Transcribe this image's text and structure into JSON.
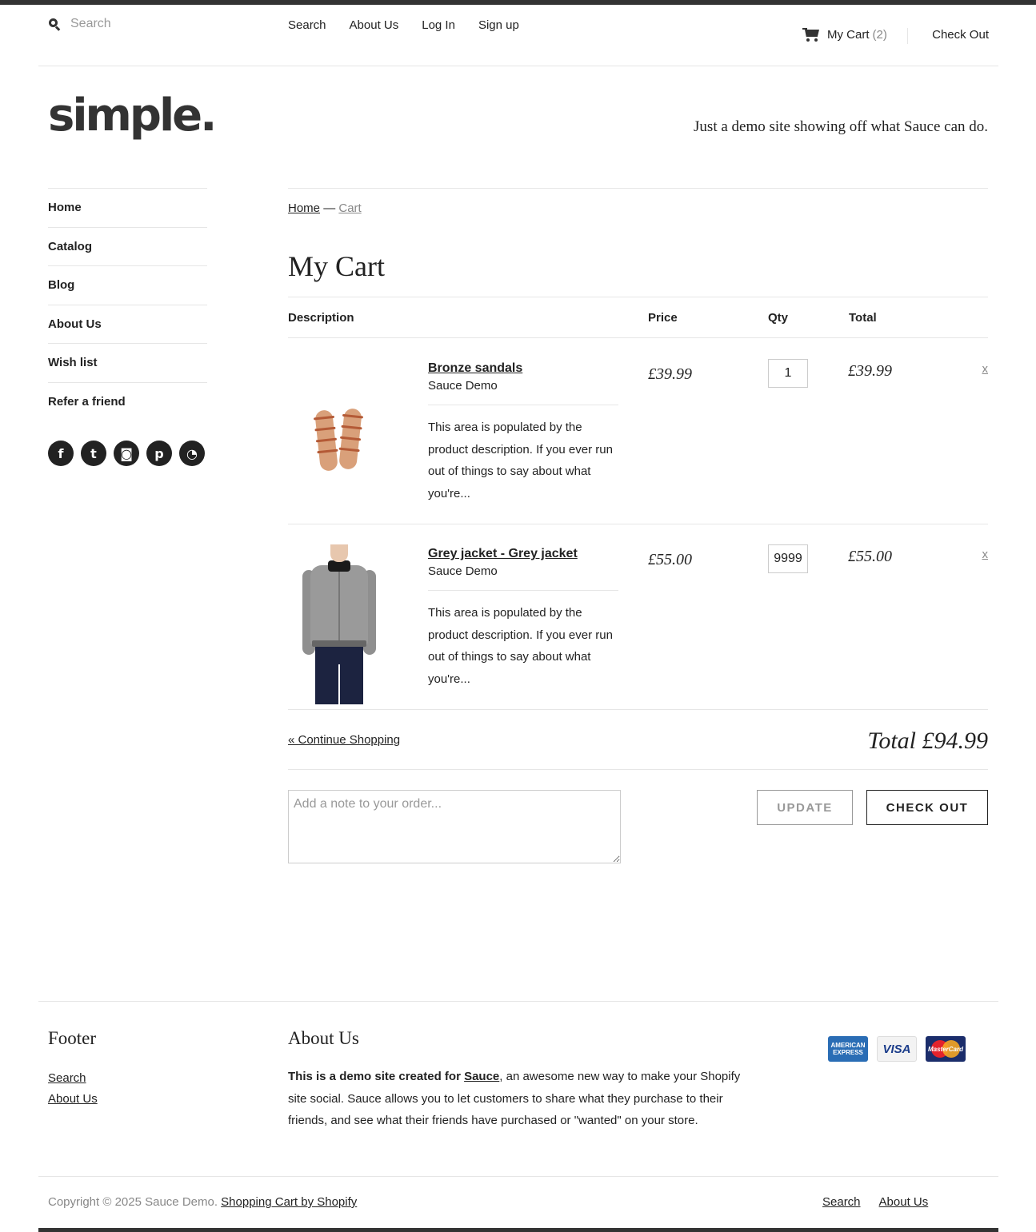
{
  "header": {
    "search_placeholder": "Search",
    "nav": [
      "Search",
      "About Us",
      "Log In",
      "Sign up"
    ],
    "cart_label": "My Cart",
    "cart_count": "(2)",
    "checkout_label": "Check Out"
  },
  "brand": {
    "logo": "simple.",
    "tagline": "Just a demo site showing off what Sauce can do."
  },
  "sidebar": {
    "items": [
      "Home",
      "Catalog",
      "Blog",
      "About Us",
      "Wish list",
      "Refer a friend"
    ],
    "social": [
      {
        "icon": "facebook-icon",
        "glyph": "f"
      },
      {
        "icon": "twitter-icon",
        "glyph": "t"
      },
      {
        "icon": "instagram-icon",
        "glyph": "◙"
      },
      {
        "icon": "pinterest-icon",
        "glyph": "p"
      },
      {
        "icon": "rss-icon",
        "glyph": "◔"
      }
    ]
  },
  "breadcrumb": {
    "home": "Home",
    "sep": "—",
    "current": "Cart"
  },
  "cart": {
    "title": "My Cart",
    "columns": {
      "description": "Description",
      "price": "Price",
      "qty": "Qty",
      "total": "Total"
    },
    "items": [
      {
        "name": "Bronze sandals",
        "vendor": "Sauce Demo",
        "description": "This area is populated by the product description. If you ever run out of things to say about what you're...",
        "price": "£39.99",
        "qty": "1",
        "total": "£39.99",
        "remove": "x"
      },
      {
        "name": "Grey jacket - Grey jacket",
        "vendor": "Sauce Demo",
        "description": "This area is populated by the product description. If you ever run out of things to say about what you're...",
        "price": "£55.00",
        "qty": "9999",
        "total": "£55.00",
        "remove": "x"
      }
    ],
    "continue": "« Continue Shopping",
    "grand_total": "Total £94.99",
    "note_placeholder": "Add a note to your order...",
    "update_label": "UPDATE",
    "checkout_label": "CHECK OUT"
  },
  "footer": {
    "heading": "Footer",
    "links": [
      "Search",
      "About Us"
    ],
    "about_heading": "About Us",
    "about_bold": "This is a demo site created for ",
    "about_link": "Sauce",
    "about_rest": ", an awesome new way to make your Shopify site social. Sauce allows you to let customers to share what they purchase to their friends, and see what their friends have purchased or \"wanted\" on your store.",
    "cards": {
      "amex": "AMERICAN EXPRESS",
      "visa": "VISA",
      "mastercard": "MasterCard"
    },
    "copyright": "Copyright © 2025 Sauce Demo.",
    "powered": "Shopping Cart by Shopify",
    "bottom_links": [
      "Search",
      "About Us"
    ]
  },
  "colors": {
    "text": "#222222",
    "muted": "#888888",
    "rule": "#e6e6e6",
    "bar": "#333333"
  }
}
